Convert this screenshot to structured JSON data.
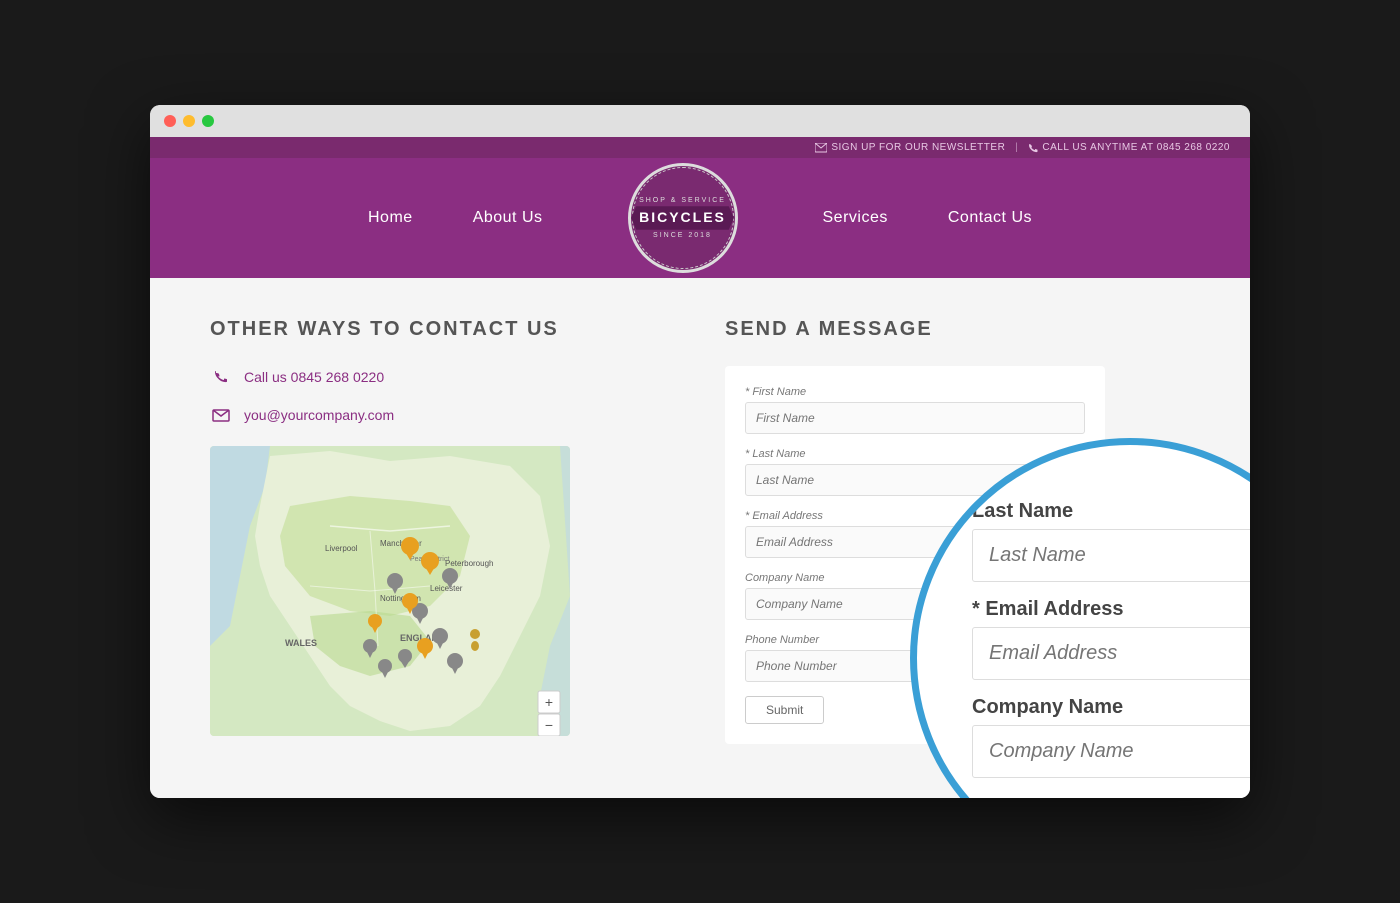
{
  "browser": {
    "dots": [
      "red",
      "yellow",
      "green"
    ]
  },
  "infobar": {
    "newsletter": "SIGN UP FOR OUR NEWSLETTER",
    "separator": "|",
    "phone": "CALL US ANYTIME AT 0845 268 0220"
  },
  "nav": {
    "home": "Home",
    "about": "About Us",
    "services": "Services",
    "contact": "Contact Us",
    "logo": {
      "top": "SHOP & SERVICE",
      "main": "BICYCLES",
      "bottom": "SINCE 2018"
    }
  },
  "left": {
    "title": "OTHER WAYS TO CONTACT US",
    "phone_label": "Call us 0845 268 0220",
    "email_label": "you@yourcompany.com"
  },
  "right": {
    "title": "SEND A MESSAGE",
    "form": {
      "first_name_label": "* First Name",
      "first_name_placeholder": "First Name",
      "last_name_label": "* Last Name",
      "last_name_placeholder": "Last Name",
      "email_label": "* Email Address",
      "email_placeholder": "Email Address",
      "company_label": "Company Name",
      "company_placeholder": "Company Name",
      "phone_label": "Phone Number",
      "phone_placeholder": "Phone Number",
      "submit": "Submit"
    }
  },
  "zoom": {
    "last_name_label": "Last Name",
    "last_name_placeholder": "Last Name",
    "email_label": "* Email Address",
    "email_placeholder": "Email Address",
    "company_label": "Company Name",
    "company_placeholder": "Company Name"
  }
}
